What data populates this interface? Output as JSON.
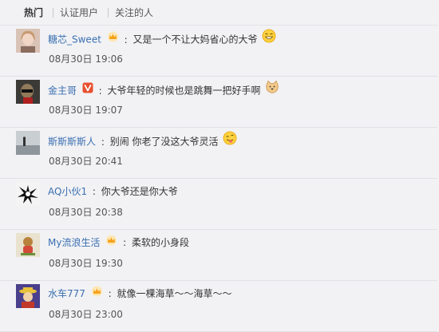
{
  "tabs": [
    {
      "label": "热门",
      "active": true
    },
    {
      "label": "认证用户",
      "active": false
    },
    {
      "label": "关注的人",
      "active": false
    }
  ],
  "comments": [
    {
      "user": "糖芯_Sweet",
      "badge": "crown",
      "text": "又是一个不让大妈省心的大爷",
      "emoji": "laugh-emoji",
      "time": "08月30日 19:06"
    },
    {
      "user": "金主哥",
      "badge": "verified-v",
      "text": "大爷年轻的时候也是跳舞一把好手啊",
      "emoji": "doge-emoji",
      "time": "08月30日 19:07"
    },
    {
      "user": "斯斯斯斯人",
      "badge": null,
      "text": "别闹 你老了没这大爷灵活",
      "emoji": "tongue-emoji",
      "time": "08月30日 20:41"
    },
    {
      "user": "AQ小伙1",
      "badge": null,
      "text": "你大爷还是你大爷",
      "emoji": null,
      "time": "08月30日 20:38"
    },
    {
      "user": "My流浪生活",
      "badge": "crown",
      "text": "柔软的小身段",
      "emoji": null,
      "time": "08月30日 19:30"
    },
    {
      "user": "水车777",
      "badge": "crown",
      "text": "就像一棵海草～～海草～～",
      "emoji": null,
      "time": "08月30日 23:00"
    }
  ],
  "colors": {
    "link": "#3a6fb0",
    "crown": "#f7a11a",
    "verified": "#e8502f",
    "background": "#f2f2f5"
  }
}
